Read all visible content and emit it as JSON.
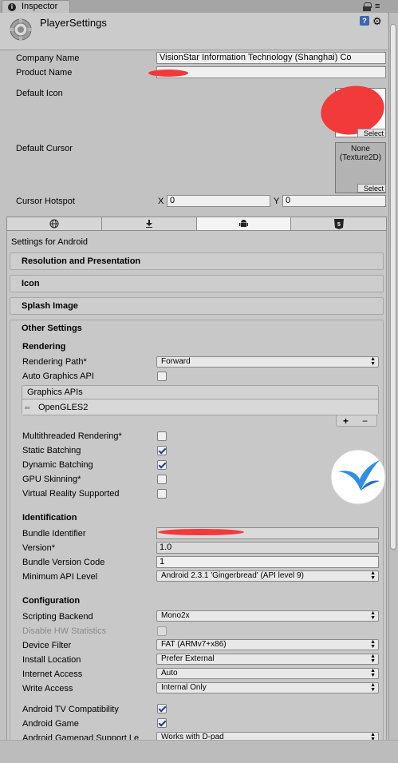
{
  "window_tab": {
    "label": "Inspector"
  },
  "header": {
    "title": "PlayerSettings"
  },
  "company_name": {
    "label": "Company Name",
    "value": "VisionStar Information Technology (Shanghai) Co"
  },
  "product_name": {
    "label": "Product Name",
    "value": ""
  },
  "default_icon": {
    "label": "Default Icon",
    "select": "Select"
  },
  "default_cursor": {
    "label": "Default Cursor",
    "slot_line1": "None",
    "slot_line2": "(Texture2D)",
    "select": "Select"
  },
  "cursor_hotspot": {
    "label": "Cursor Hotspot",
    "x_label": "X",
    "x_value": "0",
    "y_label": "Y",
    "y_value": "0"
  },
  "platform_tabs": [
    {
      "name": "web-globe",
      "icon": "globe-icon"
    },
    {
      "name": "standalone",
      "icon": "download-icon"
    },
    {
      "name": "android",
      "icon": "android-icon"
    },
    {
      "name": "html5",
      "icon": "html5-icon"
    }
  ],
  "settings_for": "Settings for Android",
  "sections": {
    "resolution": "Resolution and Presentation",
    "icon": "Icon",
    "splash": "Splash Image",
    "other": "Other Settings"
  },
  "rendering": {
    "title": "Rendering",
    "rendering_path": {
      "label": "Rendering Path*",
      "value": "Forward"
    },
    "auto_graphics_api": {
      "label": "Auto Graphics API",
      "checked": false
    },
    "graphics_apis": {
      "header": "Graphics APIs",
      "items": [
        "OpenGLES2"
      ],
      "add": "+",
      "remove": "−"
    },
    "multithreaded": {
      "label": "Multithreaded Rendering*",
      "checked": false
    },
    "static_batching": {
      "label": "Static Batching",
      "checked": true
    },
    "dynamic_batching": {
      "label": "Dynamic Batching",
      "checked": true
    },
    "gpu_skinning": {
      "label": "GPU Skinning*",
      "checked": false
    },
    "vr_supported": {
      "label": "Virtual Reality Supported",
      "checked": false
    }
  },
  "identification": {
    "title": "Identification",
    "bundle_identifier": {
      "label": "Bundle Identifier",
      "value": ""
    },
    "version": {
      "label": "Version*",
      "value": "1.0"
    },
    "bundle_version_code": {
      "label": "Bundle Version Code",
      "value": "1"
    },
    "min_api_level": {
      "label": "Minimum API Level",
      "value": "Android 2.3.1 'Gingerbread' (API level 9)"
    }
  },
  "configuration": {
    "title": "Configuration",
    "scripting_backend": {
      "label": "Scripting Backend",
      "value": "Mono2x"
    },
    "disable_hw_stats": {
      "label": "Disable HW Statistics",
      "checked": false
    },
    "device_filter": {
      "label": "Device Filter",
      "value": "FAT (ARMv7+x86)"
    },
    "install_location": {
      "label": "Install Location",
      "value": "Prefer External"
    },
    "internet_access": {
      "label": "Internet Access",
      "value": "Auto"
    },
    "write_access": {
      "label": "Write Access",
      "value": "Internal Only"
    },
    "android_tv": {
      "label": "Android TV Compatibility",
      "checked": true
    },
    "android_game": {
      "label": "Android Game",
      "checked": true
    },
    "gamepad_support": {
      "label": "Android Gamepad Support Le",
      "value": "Works with D-pad"
    }
  }
}
